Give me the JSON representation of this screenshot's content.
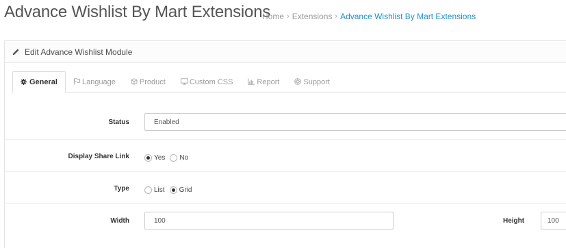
{
  "header": {
    "title": "Advance Wishlist By Mart Extensions",
    "breadcrumb": [
      {
        "label": "Home"
      },
      {
        "label": "Extensions"
      },
      {
        "label": "Advance Wishlist By Mart Extensions"
      }
    ],
    "separator": "›"
  },
  "panel": {
    "title": "Edit Advance Wishlist Module",
    "title_icon": "pencil-icon"
  },
  "tabs": [
    {
      "label": "General",
      "icon": "gear-icon",
      "active": true
    },
    {
      "label": "Language",
      "icon": "flag-icon"
    },
    {
      "label": "Product",
      "icon": "cube-icon"
    },
    {
      "label": "Custom CSS",
      "icon": "monitor-icon"
    },
    {
      "label": "Report",
      "icon": "bar-chart-icon"
    },
    {
      "label": "Support",
      "icon": "lifebuoy-icon"
    }
  ],
  "form": {
    "status": {
      "label": "Status",
      "value": "Enabled"
    },
    "share_link": {
      "label": "Display Share Link",
      "options": [
        "Yes",
        "No"
      ],
      "selected": "Yes"
    },
    "type": {
      "label": "Type",
      "options": [
        "List",
        "Grid"
      ],
      "selected": "Grid"
    },
    "width": {
      "label": "Width",
      "value": "100"
    },
    "height": {
      "label": "Height",
      "value": "100"
    }
  },
  "colors": {
    "link": "#1e91cf",
    "muted": "#999999",
    "border": "#cccccc"
  }
}
